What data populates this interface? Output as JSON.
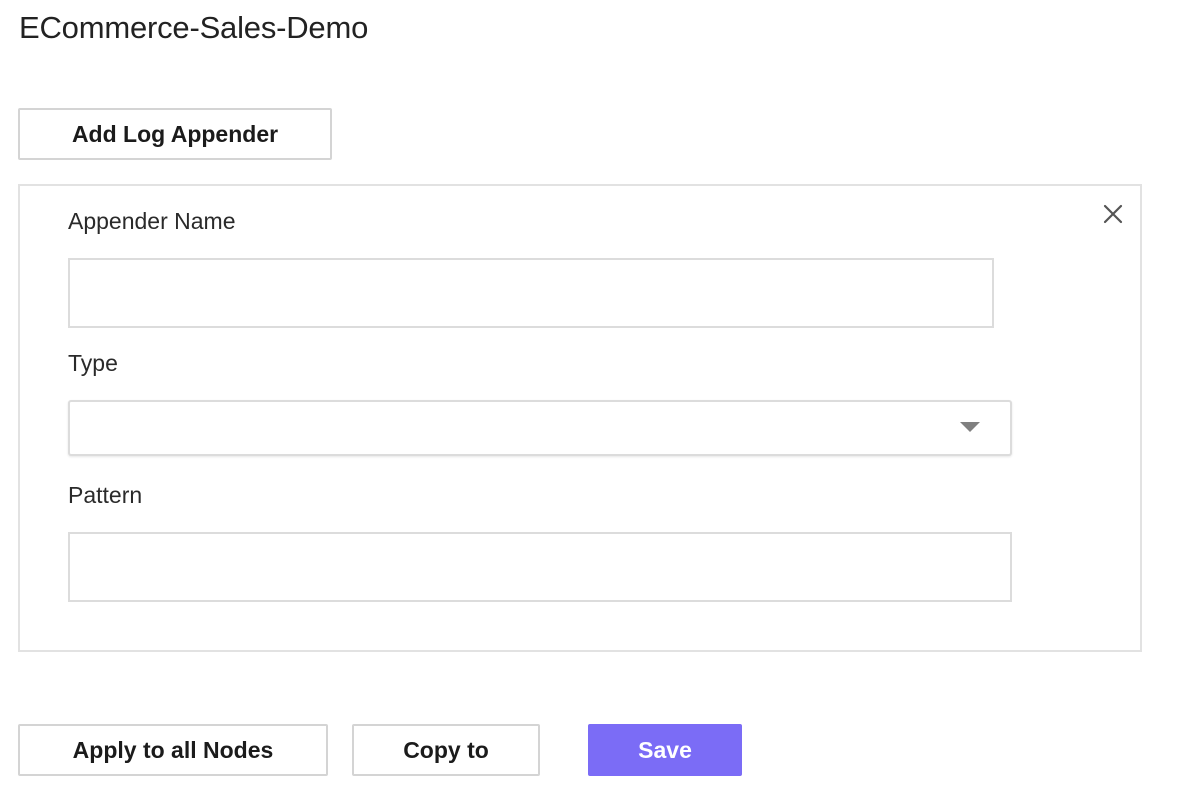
{
  "page": {
    "title": "ECommerce-Sales-Demo"
  },
  "toolbar": {
    "add_log_appender_label": "Add Log Appender"
  },
  "appender_form": {
    "name_label": "Appender Name",
    "name_value": "",
    "type_label": "Type",
    "type_value": "",
    "pattern_label": "Pattern",
    "pattern_value": "",
    "close_icon": "close-icon",
    "dropdown_icon": "caret-down-icon"
  },
  "footer": {
    "apply_label": "Apply to all Nodes",
    "copy_label": "Copy to",
    "save_label": "Save"
  },
  "colors": {
    "primary": "#7b6cf6",
    "border": "#dcdcdc",
    "text": "#1e1e1e"
  }
}
